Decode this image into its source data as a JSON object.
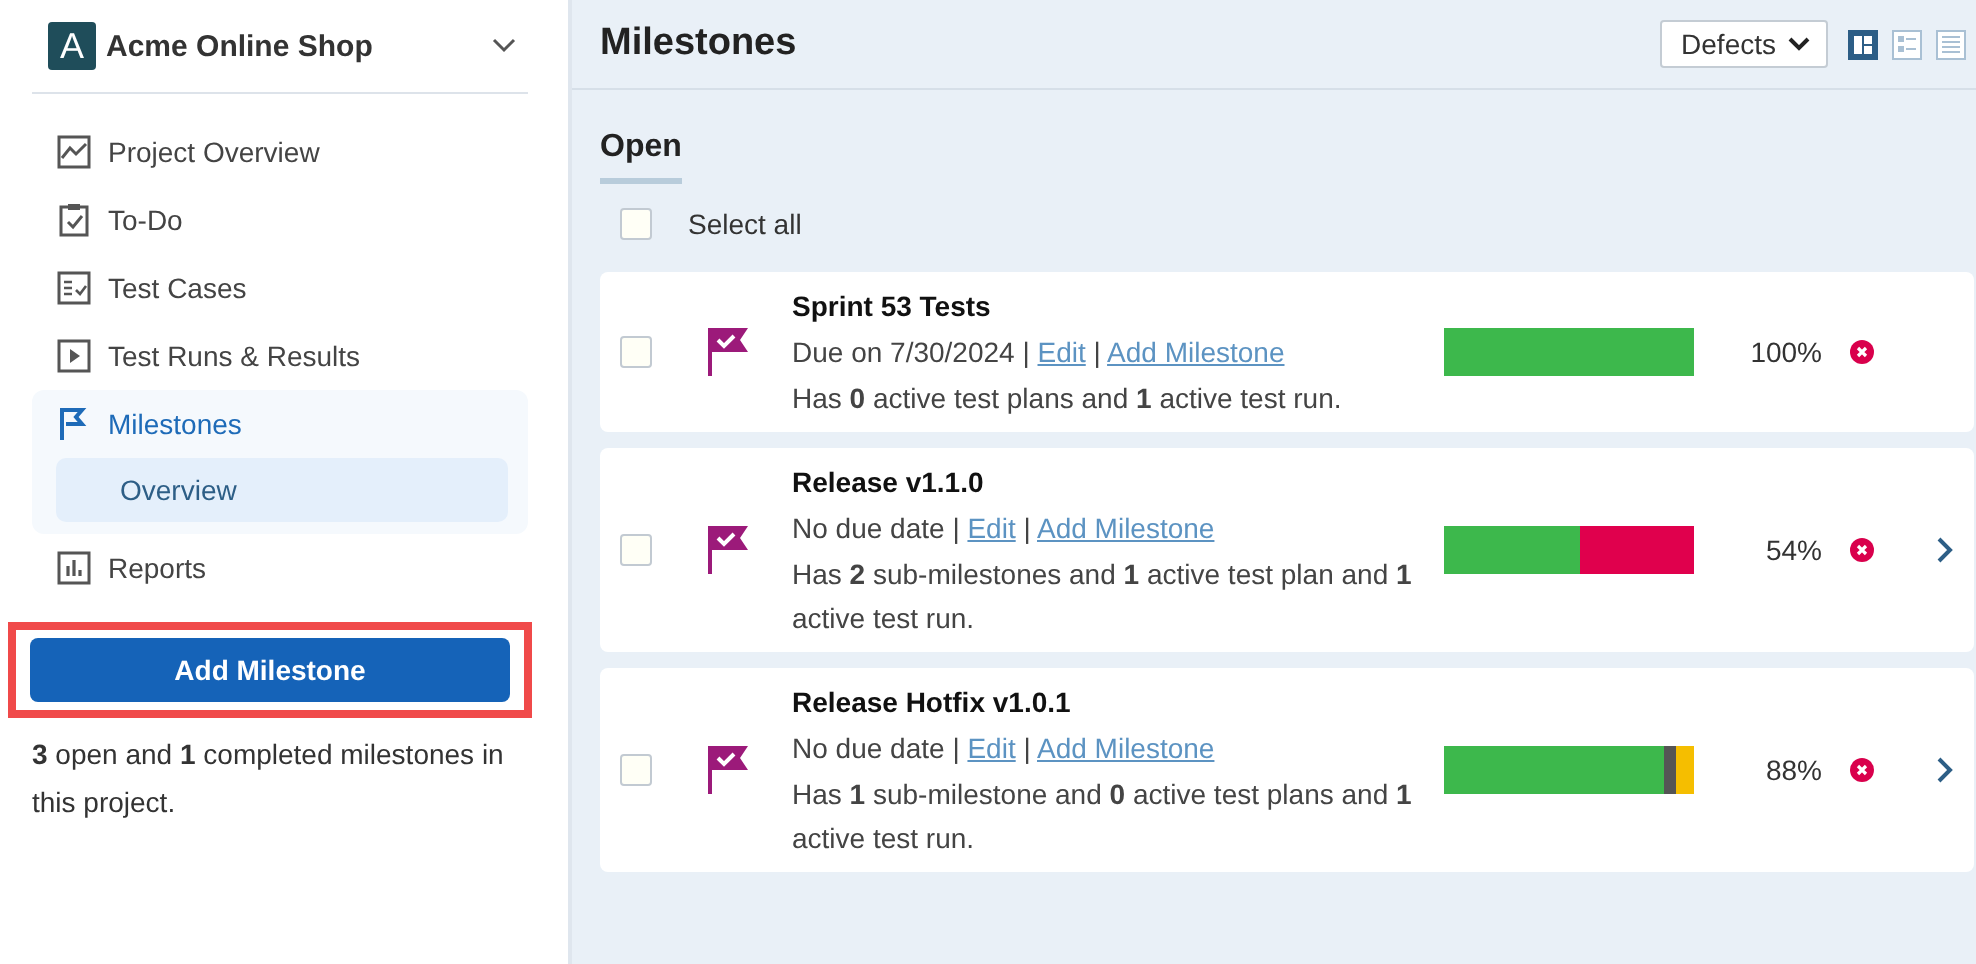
{
  "sidebar": {
    "project": {
      "initial": "A",
      "name": "Acme Online Shop"
    },
    "items": [
      {
        "label": "Project Overview",
        "kind": "chart",
        "selected": false
      },
      {
        "label": "To-Do",
        "kind": "todo",
        "selected": false
      },
      {
        "label": "Test Cases",
        "kind": "cases",
        "selected": false
      },
      {
        "label": "Test Runs & Results",
        "kind": "play",
        "selected": false
      },
      {
        "label": "Milestones",
        "kind": "flag",
        "selected": true,
        "children": [
          {
            "label": "Overview",
            "selected": true
          }
        ]
      },
      {
        "label": "Reports",
        "kind": "reports",
        "selected": false
      }
    ],
    "add_button": {
      "label": "Add Milestone",
      "highlighted": true
    },
    "summary": "**3** open and **1** completed milestones in this project."
  },
  "header": {
    "title": "Milestones",
    "dropdown": "Defects",
    "view_modes": [
      {
        "kind": "board",
        "selected": true
      },
      {
        "kind": "detail",
        "selected": false
      },
      {
        "kind": "list",
        "selected": false
      }
    ]
  },
  "section": {
    "title": "Open",
    "select_all": {
      "label": "Select all",
      "checked": false
    }
  },
  "milestones": [
    {
      "name": "Sprint 53 Tests",
      "due": "Due on 7/30/2024",
      "sep": "|",
      "edit": "Edit",
      "add": "Add Milestone",
      "summary": "Has **0** active test plans and **1** active test run.",
      "checked": false,
      "expandable": false,
      "percent": "100%",
      "segments": [
        {
          "color": "#3db84c",
          "level": 1
        }
      ]
    },
    {
      "name": "Release v1.1.0",
      "due": "No due date",
      "sep": "|",
      "edit": "Edit",
      "add": "Add Milestone",
      "summary": "Has **2** sub-milestones and **1** active test plan and **1** active test run.",
      "checked": false,
      "expandable": true,
      "percent": "54%",
      "segments": [
        {
          "color": "#3db84c",
          "level": 0.54
        },
        {
          "color": "#e0004d",
          "level": 0.46
        }
      ]
    },
    {
      "name": "Release Hotfix v1.0.1",
      "due": "No due date",
      "sep": "|",
      "edit": "Edit",
      "add": "Add Milestone",
      "summary": "Has **1** sub-milestone and **0** active test plans and **1** active test run.",
      "checked": false,
      "expandable": true,
      "percent": "88%",
      "segments": [
        {
          "color": "#3db84c",
          "level": 0.88
        },
        {
          "color": "#555555"
        },
        {
          "color": "#f5be00",
          "level": 0.07
        }
      ]
    }
  ]
}
